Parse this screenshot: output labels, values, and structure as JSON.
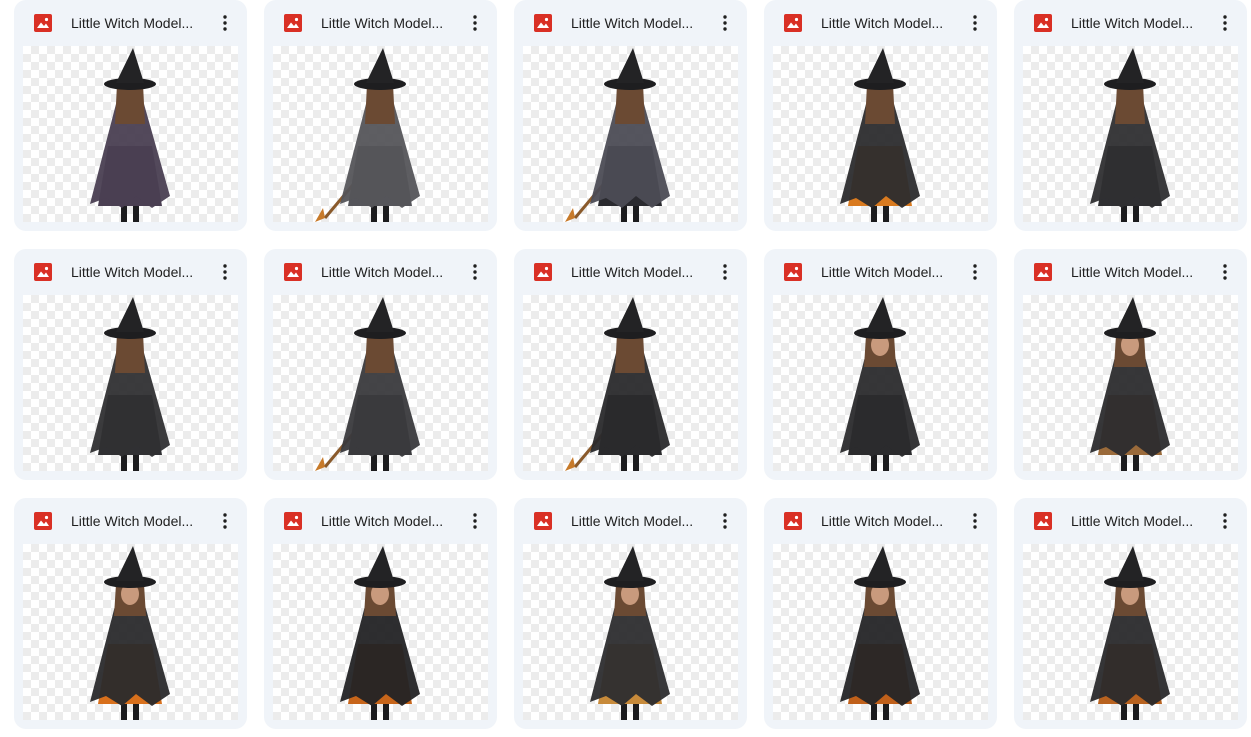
{
  "files": [
    {
      "title": "Little Witch Model...",
      "icon": "image-file-icon",
      "figure": "back-view",
      "dress_color": "#4a3f52",
      "accent_color": "#4a3f52",
      "broom": false
    },
    {
      "title": "Little Witch Model...",
      "icon": "image-file-icon",
      "figure": "back-view",
      "dress_color": "#55555a",
      "accent_color": "#55555a",
      "broom": true
    },
    {
      "title": "Little Witch Model...",
      "icon": "image-file-icon",
      "figure": "back-view",
      "dress_color": "#4c4c55",
      "accent_color": "#2a2a2f",
      "broom": true
    },
    {
      "title": "Little Witch Model...",
      "icon": "image-file-icon",
      "figure": "back-view",
      "dress_color": "#2c2c2e",
      "accent_color": "#d97a1f",
      "broom": false
    },
    {
      "title": "Little Witch Model...",
      "icon": "image-file-icon",
      "figure": "back-view",
      "dress_color": "#2f2f32",
      "accent_color": "#2f2f32",
      "broom": false
    },
    {
      "title": "Little Witch Model...",
      "icon": "image-file-icon",
      "figure": "back-view",
      "dress_color": "#303033",
      "accent_color": "#303033",
      "broom": false
    },
    {
      "title": "Little Witch Model...",
      "icon": "image-file-icon",
      "figure": "side-view",
      "dress_color": "#3a3a3d",
      "accent_color": "#3a3a3d",
      "broom": true
    },
    {
      "title": "Little Witch Model...",
      "icon": "image-file-icon",
      "figure": "back-view",
      "dress_color": "#2a2a2c",
      "accent_color": "#2a2a2c",
      "broom": true
    },
    {
      "title": "Little Witch Model...",
      "icon": "image-file-icon",
      "figure": "front-view",
      "dress_color": "#2b2b2d",
      "accent_color": "#2b2b2d",
      "broom": false
    },
    {
      "title": "Little Witch Model...",
      "icon": "image-file-icon",
      "figure": "front-view",
      "dress_color": "#2c2c2e",
      "accent_color": "#9a6a3a",
      "broom": false
    },
    {
      "title": "Little Witch Model...",
      "icon": "image-file-icon",
      "figure": "front-view",
      "dress_color": "#2a2a2c",
      "accent_color": "#d8701c",
      "broom": false
    },
    {
      "title": "Little Witch Model...",
      "icon": "image-file-icon",
      "figure": "front-view",
      "dress_color": "#232325",
      "accent_color": "#c7651a",
      "broom": false
    },
    {
      "title": "Little Witch Model...",
      "icon": "image-file-icon",
      "figure": "front-view",
      "dress_color": "#2d2d2f",
      "accent_color": "#c78a3a",
      "broom": false
    },
    {
      "title": "Little Witch Model...",
      "icon": "image-file-icon",
      "figure": "front-view",
      "dress_color": "#252527",
      "accent_color": "#c0601a",
      "broom": false
    },
    {
      "title": "Little Witch Model...",
      "icon": "image-file-icon",
      "figure": "front-view",
      "dress_color": "#2a2a2c",
      "accent_color": "#b8621f",
      "broom": false
    }
  ]
}
